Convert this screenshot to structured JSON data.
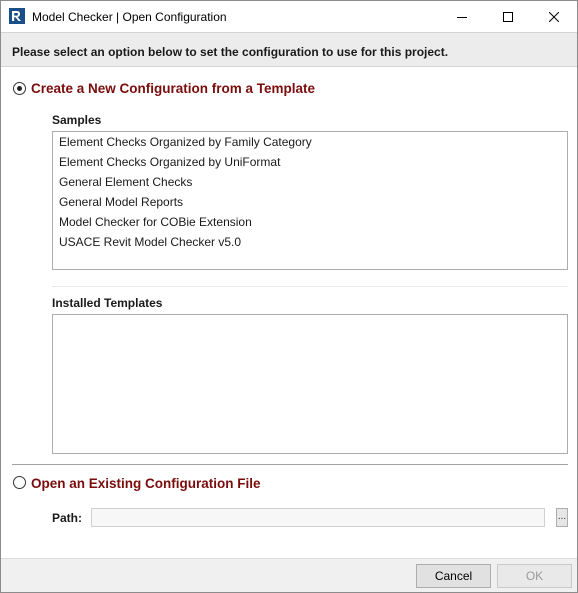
{
  "window": {
    "title": "Model Checker | Open Configuration"
  },
  "banner": {
    "text": "Please select an option below to set the configuration to use for this project."
  },
  "option_template": {
    "label": "Create a New Configuration from a Template",
    "selected": true
  },
  "samples": {
    "label": "Samples",
    "items": [
      "Element Checks Organized by Family Category",
      "Element Checks Organized by UniFormat",
      "General Element Checks",
      "General Model Reports",
      "Model Checker for COBie Extension",
      "USACE Revit Model Checker v5.0"
    ]
  },
  "installed": {
    "label": "Installed Templates",
    "items": []
  },
  "option_existing": {
    "label": "Open an Existing Configuration File",
    "selected": false
  },
  "path": {
    "label": "Path:",
    "value": "",
    "browse_label": "..."
  },
  "footer": {
    "cancel_label": "Cancel",
    "ok_label": "OK"
  },
  "colors": {
    "option_label": "#7a0c0c",
    "banner_bg": "#ececec",
    "footer_bg": "#f0f0f0"
  }
}
